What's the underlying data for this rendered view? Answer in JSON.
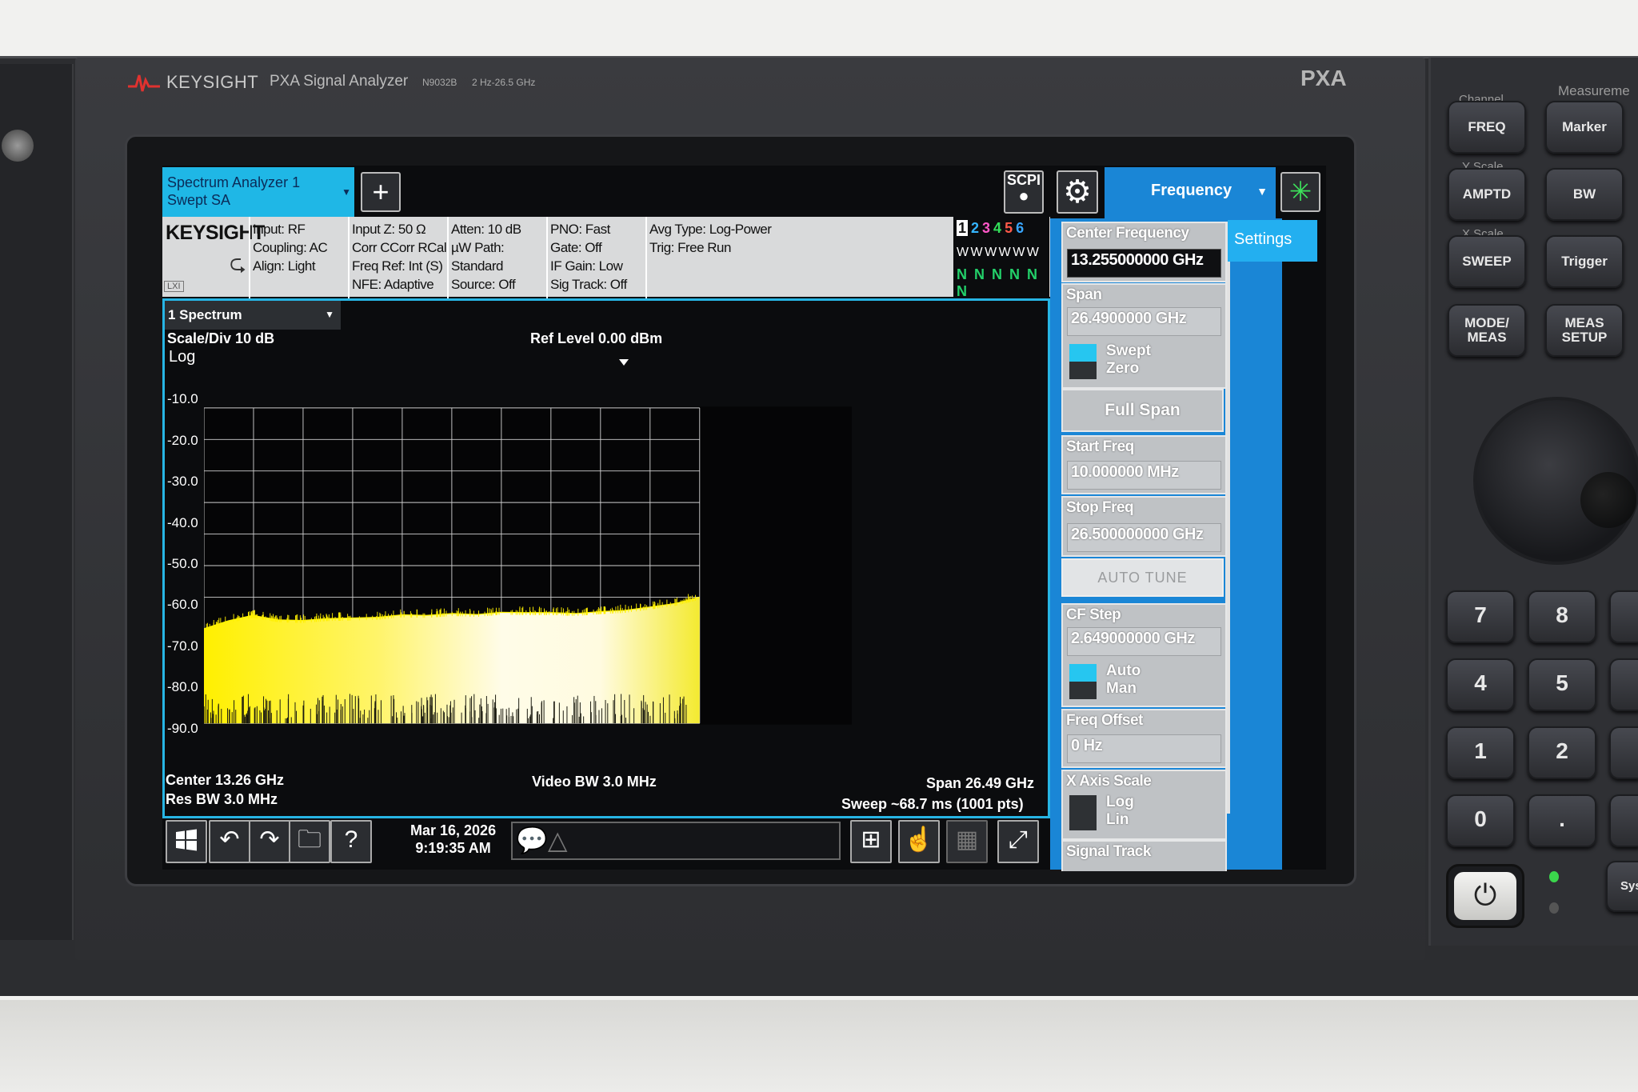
{
  "instrument": {
    "brand": "KEYSIGHT",
    "model_name": "PXA Signal Analyzer",
    "model_number": "N9032B",
    "freq_range": "2 Hz-26.5 GHz",
    "badge": "PXA"
  },
  "toolbar": {
    "screen_tab_line1": "Spectrum Analyzer 1",
    "screen_tab_line2": "Swept SA",
    "add_label": "+",
    "scpi_label": "SCPI",
    "menu_title": "Frequency",
    "settings_tab": "Settings"
  },
  "info": {
    "logo": "KEYSIGHT",
    "lxi": "LXI",
    "col1": [
      "Input: RF",
      "Coupling: AC",
      "Align: Light"
    ],
    "col2": [
      "Input Z: 50 Ω",
      "Corr CCorr RCal",
      "Freq Ref: Int (S)",
      "NFE: Adaptive"
    ],
    "col3": [
      "Atten: 10 dB",
      "µW Path: Standard",
      "Source: Off"
    ],
    "col4": [
      "PNO: Fast",
      "Gate: Off",
      "IF Gain: Low",
      "Sig Track: Off"
    ],
    "col5": [
      "Avg Type: Log-Power",
      "Trig: Free Run"
    ],
    "trace_numbers": [
      "1",
      "2",
      "3",
      "4",
      "5",
      "6"
    ],
    "trace_colors": [
      "#f2e43a",
      "#35b5ff",
      "#ff58c8",
      "#33e05a",
      "#ff5a4a",
      "#38a6ff"
    ],
    "trace_types": "W W W W W W",
    "trace_detect": "N N N N N N"
  },
  "window": {
    "title": "1 Spectrum",
    "scale_div": "Scale/Div 10 dB",
    "scale_type": "Log",
    "ref_level": "Ref Level 0.00 dBm",
    "y_ticks": [
      "-10.0",
      "-20.0",
      "-30.0",
      "-40.0",
      "-50.0",
      "-60.0",
      "-70.0",
      "-80.0",
      "-90.0"
    ],
    "center": "Center 13.26 GHz",
    "res_bw": "Res BW 3.0 MHz",
    "video_bw": "Video BW 3.0 MHz",
    "span": "Span 26.49 GHz",
    "sweep": "Sweep ~68.7 ms (1001 pts)"
  },
  "taskbar": {
    "date": "Mar 16, 2026",
    "time": "9:19:35 AM"
  },
  "menu": {
    "center_freq_label": "Center Frequency",
    "center_freq_value": "13.255000000 GHz",
    "span_label": "Span",
    "span_value": "26.4900000 GHz",
    "swept": "Swept",
    "zero": "Zero",
    "full_span": "Full Span",
    "start_freq_label": "Start Freq",
    "start_freq_value": "10.000000 MHz",
    "stop_freq_label": "Stop Freq",
    "stop_freq_value": "26.500000000 GHz",
    "auto_tune": "AUTO TUNE",
    "cf_step_label": "CF Step",
    "cf_step_value": "2.649000000 GHz",
    "auto": "Auto",
    "man": "Man",
    "freq_offset_label": "Freq Offset",
    "freq_offset_value": "0 Hz",
    "x_axis_scale_label": "X Axis Scale",
    "log": "Log",
    "lin": "Lin",
    "signal_track_label": "Signal Track"
  },
  "hardware": {
    "channel_label": "Channel",
    "measure_label": "Measureme",
    "y_scale_label": "Y Scale",
    "x_scale_label": "X Scale",
    "keys": {
      "freq": "FREQ",
      "marker": "Marker",
      "amptd": "AMPTD",
      "bw": "BW",
      "sweep": "SWEEP",
      "trigger": "Trigger",
      "mode_meas": "MODE/ MEAS",
      "meas_setup": "MEAS SETUP"
    },
    "numpad": [
      "7",
      "8",
      "4",
      "5",
      "1",
      "2",
      "0",
      "."
    ],
    "sys_label": "Sys"
  },
  "chart_data": {
    "type": "line",
    "title": "",
    "xlabel": "",
    "ylabel": "",
    "x_unit": "GHz",
    "y_unit": "dBm",
    "xlim": [
      0.01,
      26.5
    ],
    "ylim": [
      -100,
      0
    ],
    "grid": true,
    "series": [
      {
        "x": [
          0.01,
          1.3,
          2.6,
          4.0,
          5.3,
          6.6,
          8.0,
          9.3,
          10.6,
          11.9,
          13.3,
          14.6,
          15.9,
          17.2,
          18.6,
          19.9,
          21.2,
          22.5,
          23.9,
          25.2,
          26.5
        ],
        "y": [
          -70.0,
          -67.5,
          -65.8,
          -67.2,
          -67.4,
          -66.8,
          -66.6,
          -66.4,
          -65.6,
          -65.8,
          -65.2,
          -65.5,
          -64.8,
          -64.9,
          -64.9,
          -65.2,
          -64.6,
          -64.2,
          -63.1,
          -62.0,
          -60.0
        ]
      }
    ]
  }
}
